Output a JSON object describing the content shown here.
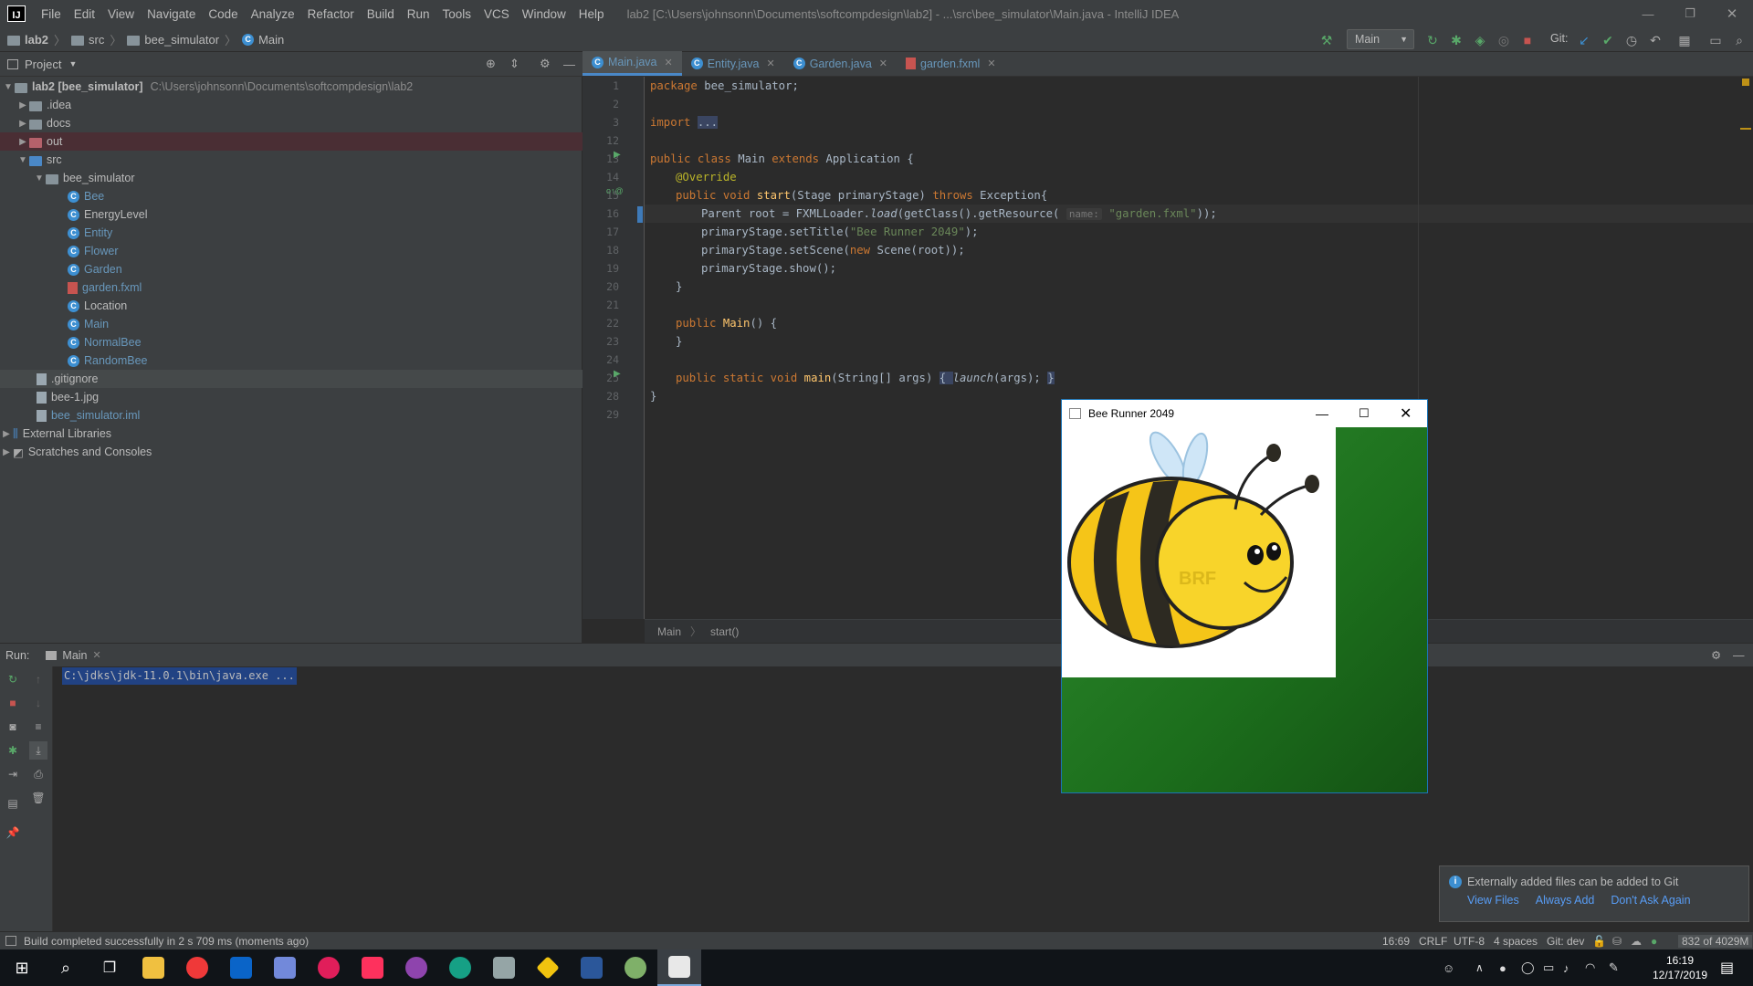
{
  "app": {
    "window_title": "lab2 [C:\\Users\\johnsonn\\Documents\\softcompdesign\\lab2] - ...\\src\\bee_simulator\\Main.java - IntelliJ IDEA",
    "menu": [
      "File",
      "Edit",
      "View",
      "Navigate",
      "Code",
      "Analyze",
      "Refactor",
      "Build",
      "Run",
      "Tools",
      "VCS",
      "Window",
      "Help"
    ]
  },
  "navbar": {
    "crumbs": [
      "lab2",
      "src",
      "bee_simulator",
      "Main"
    ],
    "run_config": "Main",
    "git_label": "Git:"
  },
  "project": {
    "header": "Project",
    "tree": [
      {
        "label": "lab2 [bee_simulator]",
        "detail": "C:\\Users\\johnsonn\\Documents\\softcompdesign\\lab2"
      },
      {
        "label": ".idea"
      },
      {
        "label": "docs"
      },
      {
        "label": "out"
      },
      {
        "label": "src"
      },
      {
        "label": "bee_simulator"
      },
      {
        "label": "Bee"
      },
      {
        "label": "EnergyLevel"
      },
      {
        "label": "Entity"
      },
      {
        "label": "Flower"
      },
      {
        "label": "Garden"
      },
      {
        "label": "garden.fxml"
      },
      {
        "label": "Location"
      },
      {
        "label": "Main"
      },
      {
        "label": "NormalBee"
      },
      {
        "label": "RandomBee"
      },
      {
        "label": ".gitignore"
      },
      {
        "label": "bee-1.jpg"
      },
      {
        "label": "bee_simulator.iml"
      },
      {
        "label": "External Libraries"
      },
      {
        "label": "Scratches and Consoles"
      }
    ]
  },
  "tabs": [
    "Main.java",
    "Entity.java",
    "Garden.java",
    "garden.fxml"
  ],
  "editor": {
    "line_numbers": [
      "1",
      "2",
      "3",
      "12",
      "13",
      "14",
      "15",
      "16",
      "17",
      "18",
      "19",
      "20",
      "21",
      "22",
      "23",
      "24",
      "25",
      "28",
      "29"
    ],
    "lines": {
      "l1_kw": "package",
      "l1_rest": " bee_simulator;",
      "l3_kw": "import",
      "l3_fold": "...",
      "l13_a": "public class",
      "l13_b": " Main ",
      "l13_c": "extends",
      "l13_d": " Application {",
      "l14": "@Override",
      "l15_a": "public void ",
      "l15_b": "start",
      "l15_c": "(Stage primaryStage) ",
      "l15_d": "throws",
      "l15_e": " Exception{",
      "l16_a": "Parent root = FXMLLoader.",
      "l16_b": "load",
      "l16_c": "(getClass().getResource(",
      "l16_hint": "name:",
      "l16_str": "\"garden.fxml\"",
      "l16_d": "));",
      "l17_a": "primaryStage.setTitle(",
      "l17_str": "\"Bee Runner 2049\"",
      "l17_b": ");",
      "l18_a": "primaryStage.setScene(",
      "l18_kw": "new",
      "l18_b": " Scene(root));",
      "l19": "primaryStage.show();",
      "l20": "}",
      "l22_a": "public ",
      "l22_b": "Main",
      "l22_c": "() {",
      "l23": "}",
      "l25_a": "public static void ",
      "l25_b": "main",
      "l25_c": "(String[] args) ",
      "l25_d": "{ ",
      "l25_e": "launch",
      "l25_f": "(args); ",
      "l25_g": "}",
      "l28": "}"
    },
    "breadcrumb": [
      "Main",
      "start()"
    ]
  },
  "run": {
    "label": "Run:",
    "tab": "Main",
    "command": "C:\\jdks\\jdk-11.0.1\\bin\\java.exe ..."
  },
  "status": {
    "message": "Build completed successfully in 2 s 709 ms (moments ago)",
    "position": "16:69",
    "line_sep": "CRLF",
    "encoding": "UTF-8",
    "indent": "4 spaces",
    "git_branch": "Git: dev",
    "memory": "832 of 4029M"
  },
  "fx_window": {
    "title": "Bee Runner 2049",
    "watermark": "BRF"
  },
  "notification": {
    "text": "Externally added files can be added to Git",
    "actions": [
      "View Files",
      "Always Add",
      "Don't Ask Again"
    ]
  },
  "taskbar": {
    "time": "16:19",
    "date": "12/17/2019",
    "apps": [
      "file-explorer",
      "vivaldi",
      "outlook",
      "discord",
      "slack",
      "intellij",
      "app-purple",
      "app-teal",
      "app-grey",
      "sourcetree",
      "word",
      "app-green",
      "java-app"
    ]
  },
  "colors": {
    "accent": "#4a88c7",
    "keyword": "#cc7832",
    "string": "#6a8759",
    "garden_green": "#1c7a1c"
  }
}
